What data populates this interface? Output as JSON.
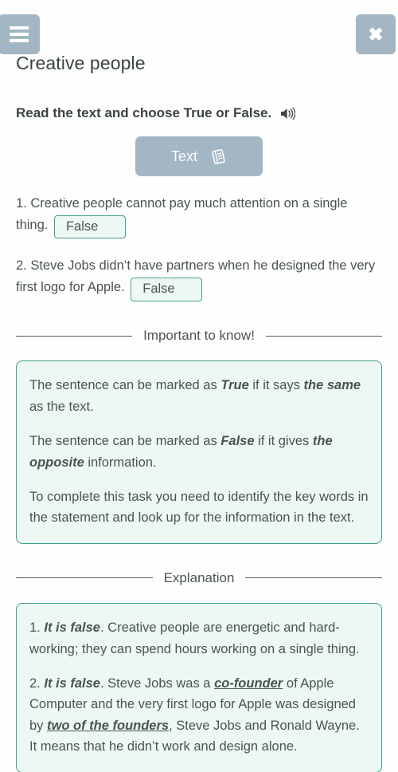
{
  "header": {
    "menu_icon": "hamburger-menu-icon",
    "close_icon": "close-icon",
    "title": "Creative people"
  },
  "task": {
    "instruction": "Read the text and choose True or False.",
    "audio_icon": "speaker-icon",
    "text_button": {
      "label": "Text",
      "icon": "book-icon"
    }
  },
  "questions": [
    {
      "prefix": "1. Creative people cannot pay much attention on a single thing.",
      "answer": "False"
    },
    {
      "prefix": "2. Steve Jobs didn’t have partners when he designed the very first logo for Apple.",
      "answer": "False"
    }
  ],
  "important": {
    "heading": "Important to know!",
    "paragraphs": [
      {
        "p1": "The sentence can be marked as ",
        "em1": "True",
        "p2": " if it says ",
        "em2": "the same",
        "p3": " as the text."
      },
      {
        "p1": "The sentence can be marked as ",
        "em1": "False",
        "p2": " if it gives ",
        "em2": "the opposite",
        "p3": " information."
      },
      {
        "p1": "To complete this task you need to identify the key words in the statement and look up for the information in the text."
      }
    ]
  },
  "explanation": {
    "heading": "Explanation",
    "items": [
      {
        "num": "1. ",
        "em1": "It is false",
        "p1": ". Creative people are energetic and hard-working; they can spend hours working on a single thing."
      },
      {
        "num": "2. ",
        "em1": "It is false",
        "p1": ". Steve Jobs was a ",
        "u1": "co-founder",
        "p2": " of Apple Computer and the very first logo for Apple was designed by ",
        "u2": "two of the founders",
        "p3": ", Steve Jobs and Ronald Wayne. It means that he didn’t work and design alone."
      }
    ]
  },
  "colors": {
    "accent_teal": "#41a08f",
    "box_bg": "#eef8f2",
    "button_gray_blue": "#a3b6c4",
    "text": "#4a5353"
  }
}
